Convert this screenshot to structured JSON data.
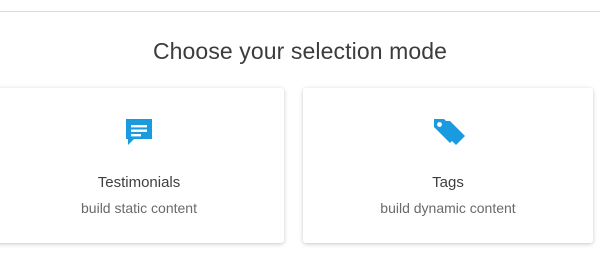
{
  "heading": "Choose your selection mode",
  "accent_color": "#1a9be0",
  "options": [
    {
      "icon": "message-icon",
      "title": "Testimonials",
      "subtitle": "build static content"
    },
    {
      "icon": "tags-icon",
      "title": "Tags",
      "subtitle": "build dynamic content"
    }
  ]
}
